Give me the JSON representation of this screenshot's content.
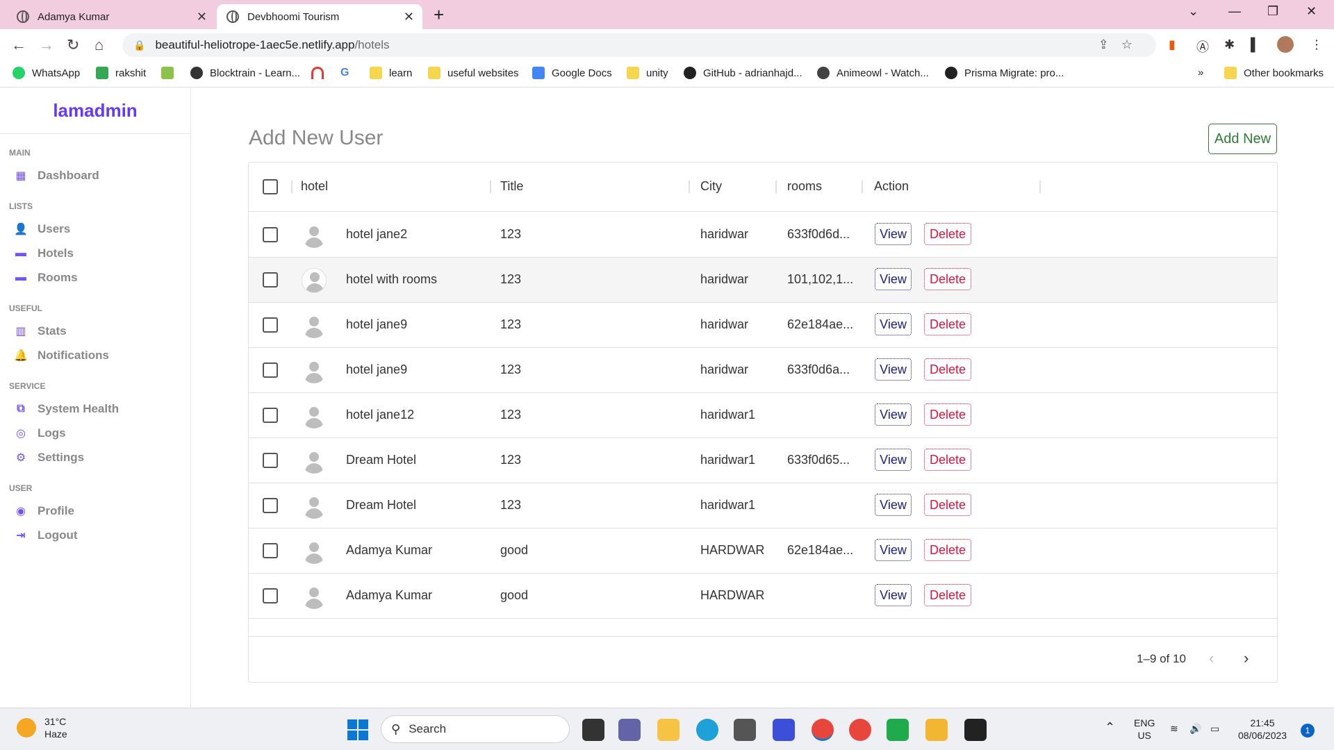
{
  "browser": {
    "tabs": [
      {
        "title": "Adamya Kumar"
      },
      {
        "title": "Devbhoomi Tourism"
      }
    ],
    "url_host": "beautiful-heliotrope-1aec5e.netlify.app",
    "url_path": "/hotels",
    "bookmarks": [
      "WhatsApp",
      "rakshit",
      "Blocktrain - Learn...",
      "learn",
      "useful websites",
      "Google Docs",
      "unity",
      "GitHub - adrianhajd...",
      "Animeowl - Watch...",
      "Prisma Migrate: pro...",
      "Other bookmarks"
    ],
    "bookmarks_overflow": "»"
  },
  "sidebar": {
    "logo": "lamadmin",
    "sections": [
      {
        "title": "MAIN",
        "items": [
          {
            "label": "Dashboard",
            "icon": "dashboard-icon"
          }
        ]
      },
      {
        "title": "LISTS",
        "items": [
          {
            "label": "Users",
            "icon": "person-icon"
          },
          {
            "label": "Hotels",
            "icon": "store-icon"
          },
          {
            "label": "Rooms",
            "icon": "store-icon"
          }
        ]
      },
      {
        "title": "USEFUL",
        "items": [
          {
            "label": "Stats",
            "icon": "chart-icon"
          },
          {
            "label": "Notifications",
            "icon": "bell-icon"
          }
        ]
      },
      {
        "title": "SERVICE",
        "items": [
          {
            "label": "System Health",
            "icon": "health-icon"
          },
          {
            "label": "Logs",
            "icon": "psychology-icon"
          },
          {
            "label": "Settings",
            "icon": "settings-icon"
          }
        ]
      },
      {
        "title": "USER",
        "items": [
          {
            "label": "Profile",
            "icon": "account-circle-icon"
          },
          {
            "label": "Logout",
            "icon": "logout-icon"
          }
        ]
      }
    ],
    "accent_color": "#6439ff"
  },
  "main": {
    "title": "Add New User",
    "add_new_label": "Add New",
    "columns": [
      "hotel",
      "Title",
      "City",
      "rooms",
      "Action"
    ],
    "view_label": "View",
    "delete_label": "Delete",
    "rows": [
      {
        "hotel": "hotel jane2",
        "title": "123",
        "city": "haridwar",
        "rooms": "633f0d6d...",
        "highlighted": false
      },
      {
        "hotel": "hotel with rooms",
        "title": "123",
        "city": "haridwar",
        "rooms": "101,102,1...",
        "highlighted": true
      },
      {
        "hotel": "hotel jane9",
        "title": "123",
        "city": "haridwar",
        "rooms": "62e184ae...",
        "highlighted": false
      },
      {
        "hotel": "hotel jane9",
        "title": "123",
        "city": "haridwar",
        "rooms": "633f0d6a...",
        "highlighted": false
      },
      {
        "hotel": "hotel jane12",
        "title": "123",
        "city": "haridwar1",
        "rooms": "",
        "highlighted": false
      },
      {
        "hotel": "Dream Hotel",
        "title": "123",
        "city": "haridwar1",
        "rooms": "633f0d65...",
        "highlighted": false
      },
      {
        "hotel": "Dream Hotel",
        "title": "123",
        "city": "haridwar1",
        "rooms": "",
        "highlighted": false
      },
      {
        "hotel": "Adamya Kumar",
        "title": "good",
        "city": "HARDWAR",
        "rooms": "62e184ae...",
        "highlighted": false
      },
      {
        "hotel": "Adamya Kumar",
        "title": "good",
        "city": "HARDWAR",
        "rooms": "",
        "highlighted": false
      }
    ],
    "pagination": "1–9 of 10"
  },
  "taskbar": {
    "temperature": "31°C",
    "weather": "Haze",
    "search_placeholder": "Search",
    "lang_top": "ENG",
    "lang_bottom": "US",
    "time": "21:45",
    "date": "08/06/2023",
    "notifications": "1"
  }
}
